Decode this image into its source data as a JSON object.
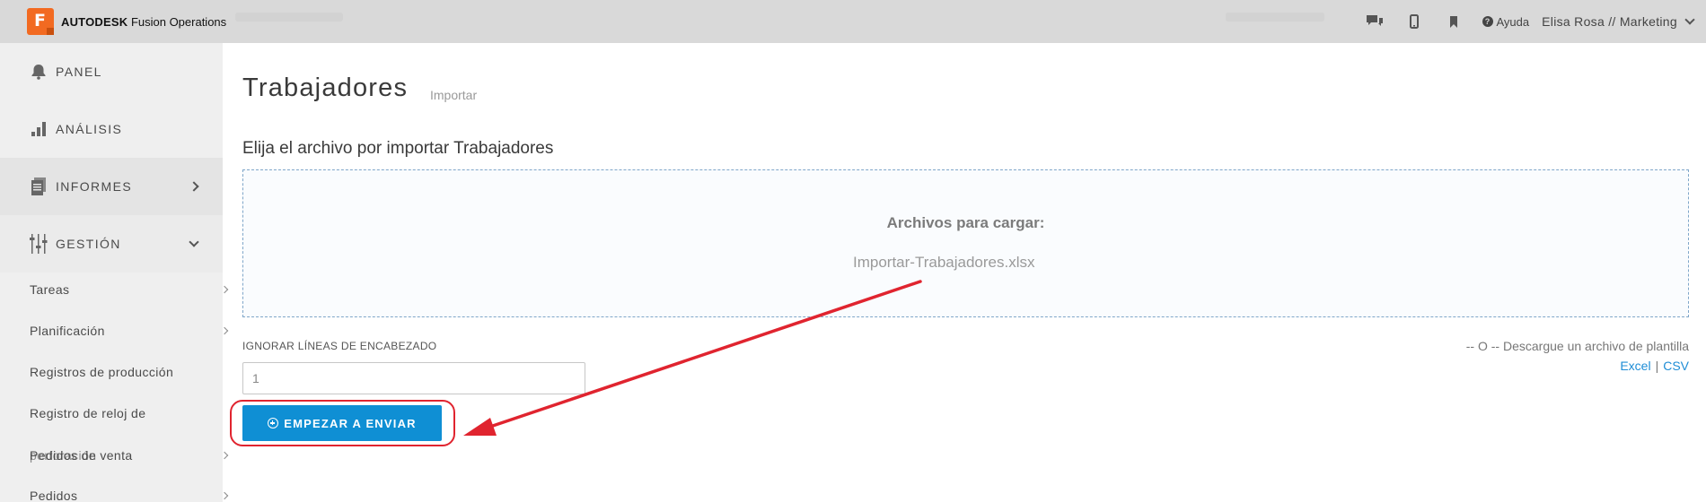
{
  "header": {
    "brand_bold": "AUTODESK",
    "brand_rest": "Fusion Operations",
    "help_label": "Ayuda",
    "user_label": "Elisa Rosa // Marketing",
    "icons": [
      "chat-icon",
      "mobile-icon",
      "bookmark-icon",
      "help-icon"
    ]
  },
  "sidebar": {
    "items": [
      {
        "label": "PANEL",
        "icon": "bell-icon"
      },
      {
        "label": "ANÁLISIS",
        "icon": "bar-chart-icon"
      },
      {
        "label": "INFORMES",
        "icon": "document-icon"
      },
      {
        "label": "GESTIÓN",
        "icon": "sliders-icon"
      }
    ],
    "sub_items": [
      {
        "label": "Tareas"
      },
      {
        "label": "Planificación"
      },
      {
        "label": "Registros de producción"
      },
      {
        "label": "Registro de reloj de"
      },
      {
        "label": "Pedidos de venta"
      },
      {
        "label": "Pedidos"
      }
    ],
    "overlap_label": "perforación"
  },
  "main": {
    "title": "Trabajadores",
    "subtitle": "Importar",
    "section_heading": "Elija el archivo por importar Trabajadores",
    "dropzone": {
      "title": "Archivos para cargar:",
      "file_name": "Importar-Trabajadores.xlsx"
    },
    "header_lines": {
      "label": "IGNORAR LÍNEAS DE ENCABEZADO",
      "value": "1"
    },
    "template": {
      "text": "-- O -- Descargue un archivo de plantilla",
      "excel_label": "Excel",
      "separator": "|",
      "csv_label": "CSV"
    },
    "submit_label": "EMPEZAR A ENVIAR"
  },
  "annotation": {
    "color": "#e0242f"
  },
  "colors": {
    "accent": "#0f8fd4",
    "link": "#1f8dd6",
    "brand": "#f26a21"
  }
}
